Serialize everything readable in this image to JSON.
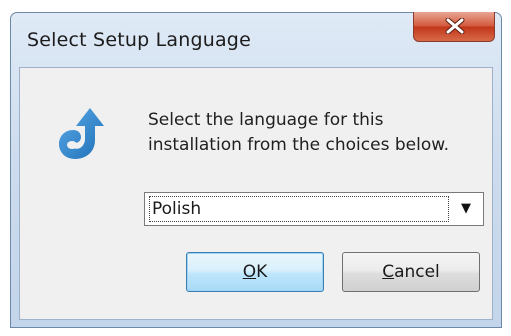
{
  "window": {
    "title": "Select Setup Language",
    "close_icon": "close-icon"
  },
  "dialog": {
    "icon": "setup-arrow-icon",
    "message": "Select the language for this\ninstallation from the choices below.",
    "language_select": {
      "value": "Polish",
      "arrow_icon": "dropdown-arrow-icon"
    }
  },
  "buttons": {
    "ok_mnemonic": "O",
    "ok_rest": "K",
    "cancel_mnemonic": "C",
    "cancel_rest": "ancel"
  },
  "colors": {
    "accent": "#3c7fb1",
    "close_red": "#c2371a",
    "title_glass": "#cddcee"
  }
}
